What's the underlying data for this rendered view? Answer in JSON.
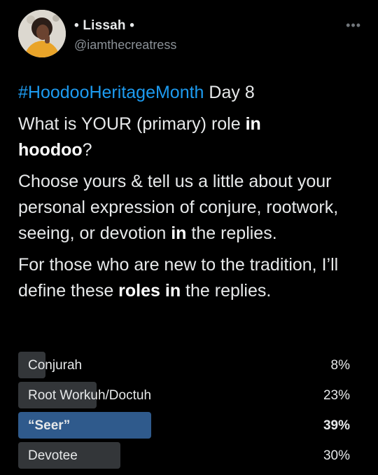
{
  "author": {
    "display_name": "• Lissah •",
    "handle": "@iamthecreatress",
    "more_icon": "more-dots-icon"
  },
  "tweet": {
    "line1_hashtag": "#HoodooHeritageMonth",
    "line1_rest": " Day 8",
    "q_a": "What is YOUR (primary) role ",
    "q_b": "in",
    "q_c": "hoodoo",
    "q_d": "?",
    "p2_a": "Choose yours & tell us a little about your personal expression of conjure, rootwork, seeing, or devotion ",
    "p2_b": "in",
    "p2_c": " the replies.",
    "p3_a": "For those who are new to the tradition, I’ll define these ",
    "p3_b": "roles in",
    "p3_c": " the replies."
  },
  "poll": {
    "options": [
      {
        "label": "Conjurah",
        "percent": "8%",
        "value": 8,
        "winner": false
      },
      {
        "label": "Root Workuh/Doctuh",
        "percent": "23%",
        "value": 23,
        "winner": false
      },
      {
        "label": "“Seer”",
        "percent": "39%",
        "value": 39,
        "winner": true
      },
      {
        "label": "Devotee",
        "percent": "30%",
        "value": 30,
        "winner": false
      }
    ],
    "winner_color": "#2f5a8c",
    "bar_color": "#333639"
  }
}
